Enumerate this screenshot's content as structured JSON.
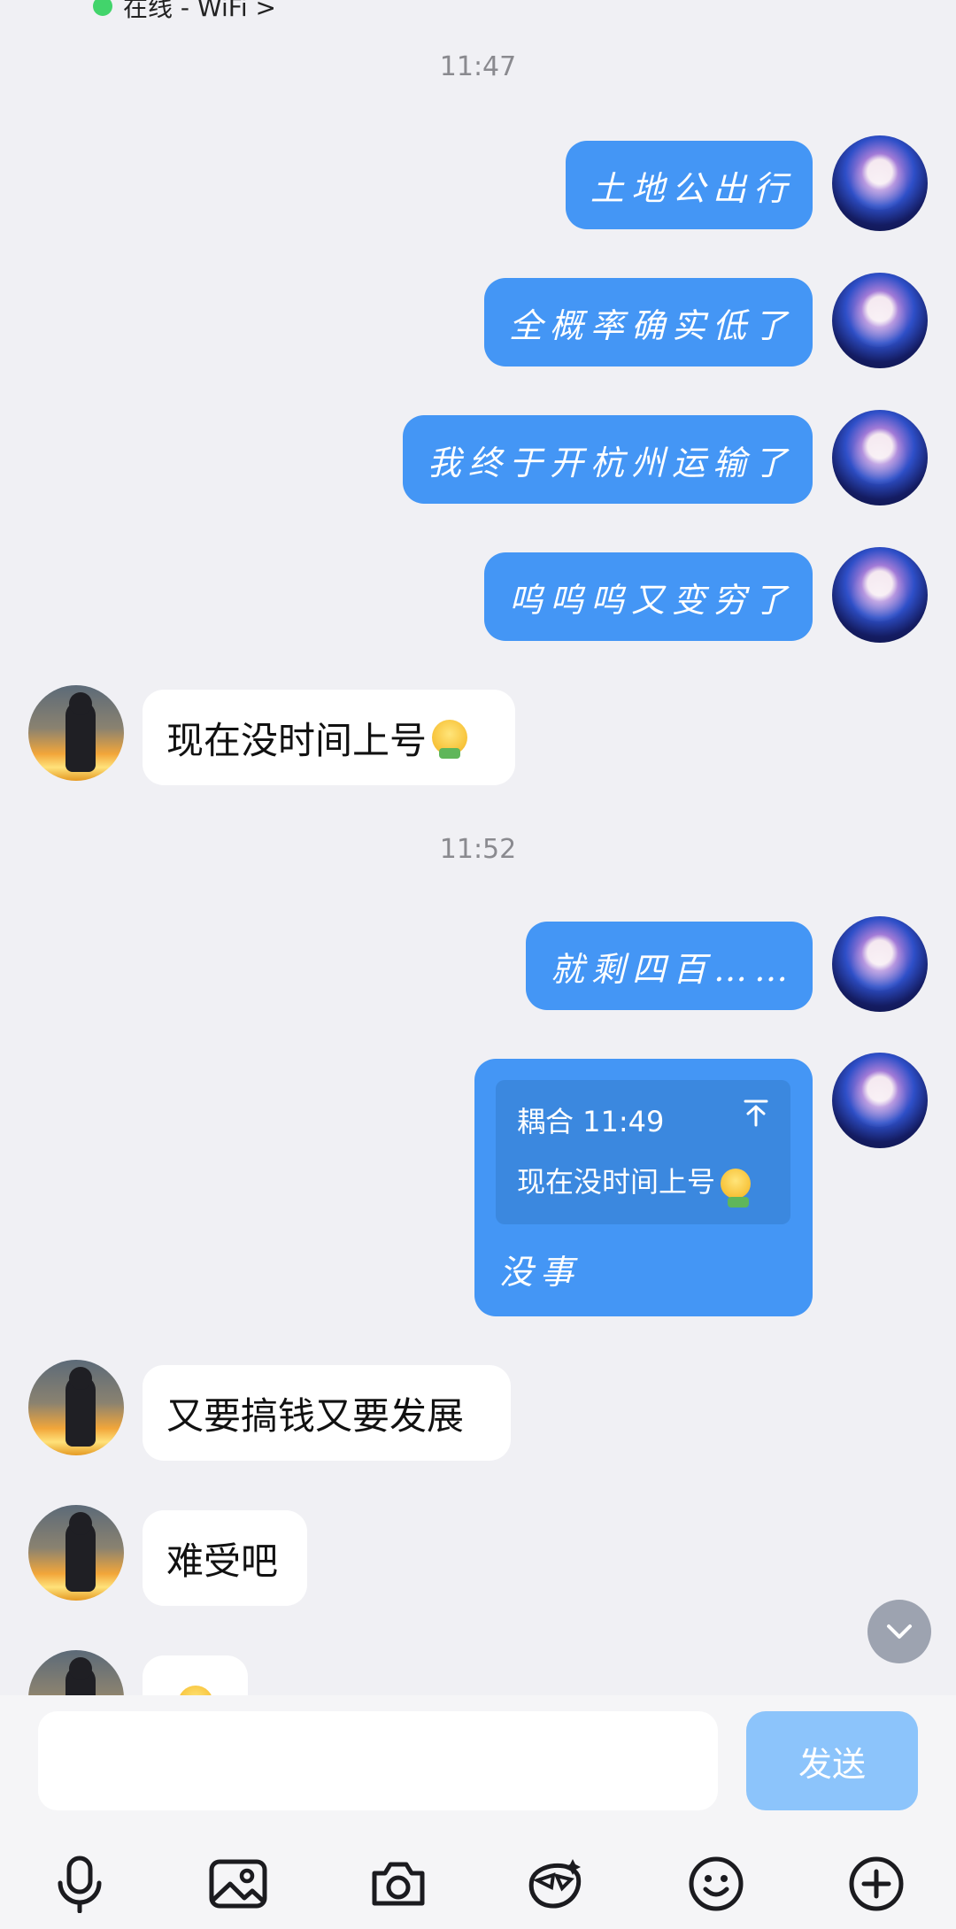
{
  "status": {
    "text": "在线 - WiFi >"
  },
  "timestamps": [
    "11:47",
    "11:52"
  ],
  "messages_out_1": [
    "土地公出行",
    "全概率确实低了",
    "我终于开杭州运输了",
    "呜呜呜又变穷了"
  ],
  "message_in_1": "现在没时间上号",
  "message_out_2": "就剩四百……",
  "reply": {
    "quote_head": "耦合 11:49",
    "quote_pin": "⊤",
    "quote_text": "现在没时间上号",
    "text": "没事"
  },
  "messages_in_2": [
    "又要搞钱又要发展",
    "难受吧"
  ],
  "composer": {
    "input_value": "",
    "send_label": "发送"
  },
  "icons": [
    "microphone-icon",
    "image-icon",
    "camera-icon",
    "sticker-icon",
    "emoji-icon",
    "plus-icon",
    "chevron-down-icon"
  ],
  "colors": {
    "accent": "#4496f5",
    "send_disabled": "#8cc4fb",
    "background": "#f0f0f4"
  }
}
